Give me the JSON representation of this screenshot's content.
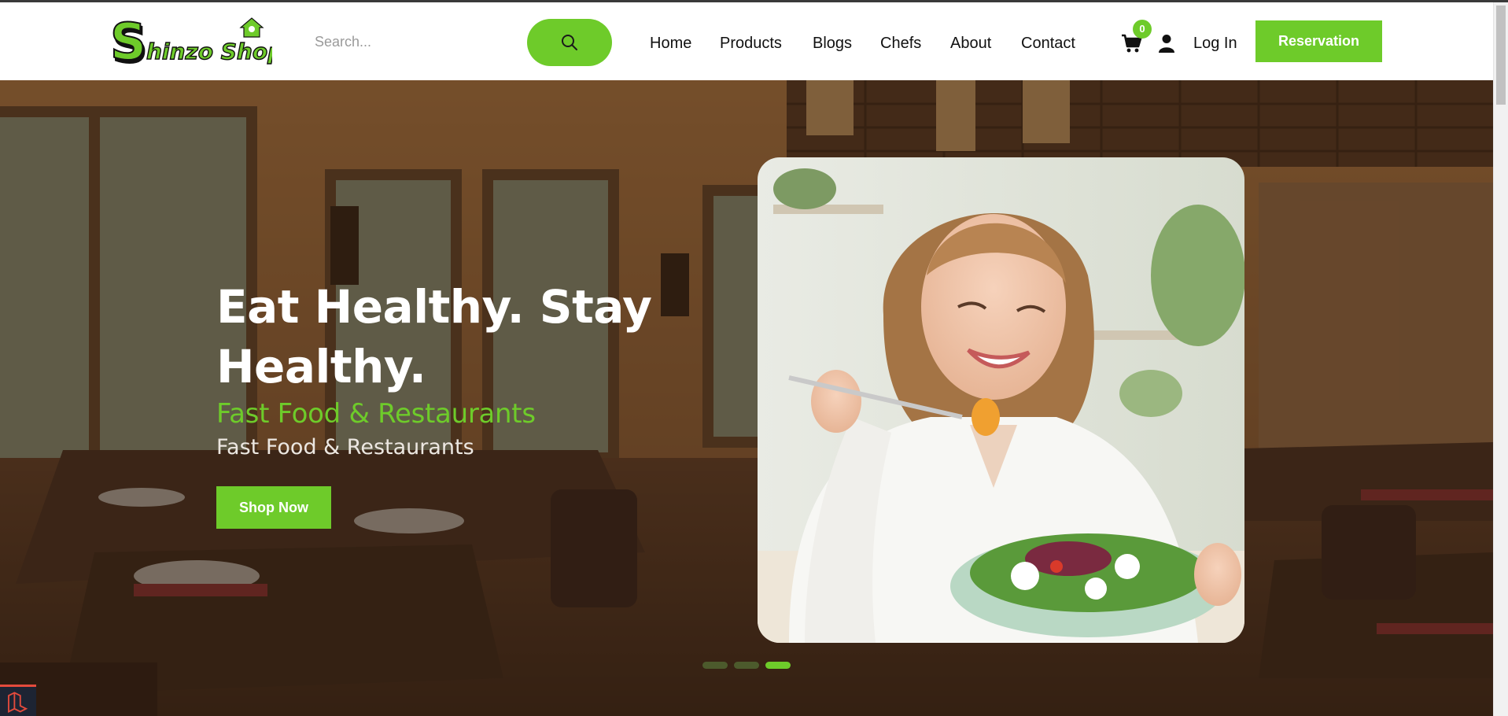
{
  "brand": {
    "logo_text": "Shinzo Shop",
    "accent_color": "#6ecb2a"
  },
  "search": {
    "placeholder": "Search...",
    "value": "",
    "button_icon": "search-icon"
  },
  "nav": {
    "items": [
      {
        "label": "Home"
      },
      {
        "label": "Products"
      },
      {
        "label": "Blogs"
      },
      {
        "label": "Chefs"
      },
      {
        "label": "About"
      },
      {
        "label": "Contact"
      }
    ]
  },
  "header_actions": {
    "cart_icon": "cart-icon",
    "cart_count": "0",
    "user_icon": "user-icon",
    "login_label": "Log In",
    "reservation_label": "Reservation"
  },
  "hero": {
    "title": "Eat Healthy. Stay Healthy.",
    "subtitle": "Fast Food & Restaurants",
    "subtitle_secondary": "Fast Food & Restaurants",
    "button_label": "Shop Now",
    "slider": {
      "total": 3,
      "active": 3
    }
  }
}
